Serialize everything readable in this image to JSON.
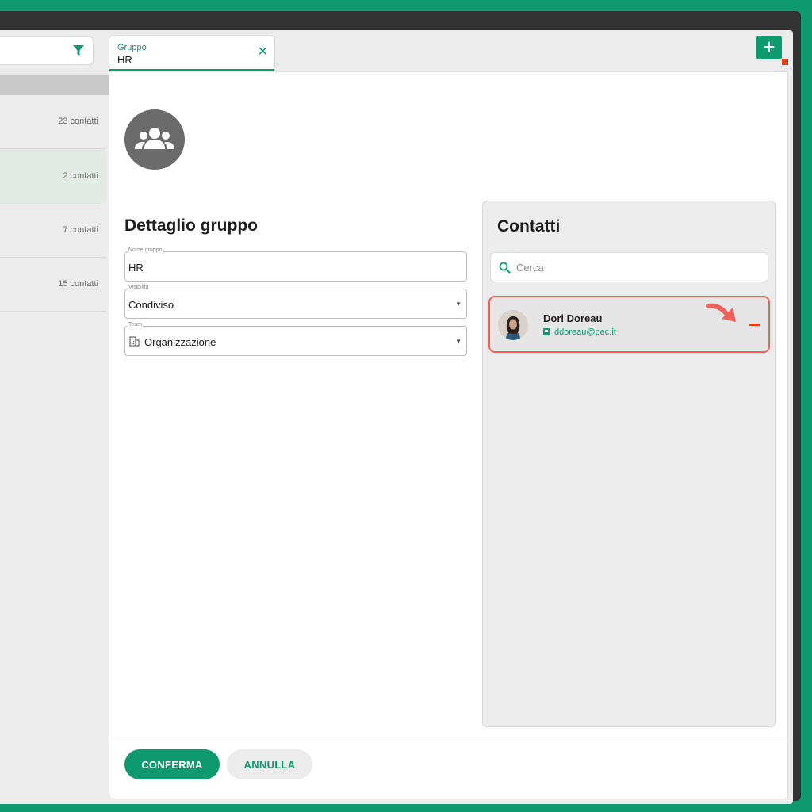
{
  "colors": {
    "accent": "#0e9a6e",
    "danger": "#e8401a",
    "highlight_border": "#f0605c"
  },
  "groups_list": {
    "items": [
      {
        "count": "23 contatti",
        "selected": false
      },
      {
        "count": "2 contatti",
        "selected": true
      },
      {
        "count": "7 contatti",
        "selected": false
      },
      {
        "count": "15 contatti",
        "selected": false
      }
    ]
  },
  "tab": {
    "label": "Gruppo",
    "title": "HR",
    "close_icon": "close-icon"
  },
  "header": {
    "add_label": "+"
  },
  "detail": {
    "title": "Dettaglio gruppo",
    "fields": {
      "name": {
        "label": "Nome gruppo",
        "value": "HR"
      },
      "visibility": {
        "label": "Visibilità",
        "value": "Condiviso"
      },
      "team": {
        "label": "Team",
        "value": "Organizzazione"
      }
    }
  },
  "contacts": {
    "title": "Contatti",
    "search": {
      "placeholder": "Cerca"
    },
    "items": [
      {
        "name": "Dori Doreau",
        "email": "ddoreau@pec.it"
      }
    ]
  },
  "footer": {
    "confirm": "CONFERMA",
    "cancel": "ANNULLA"
  }
}
